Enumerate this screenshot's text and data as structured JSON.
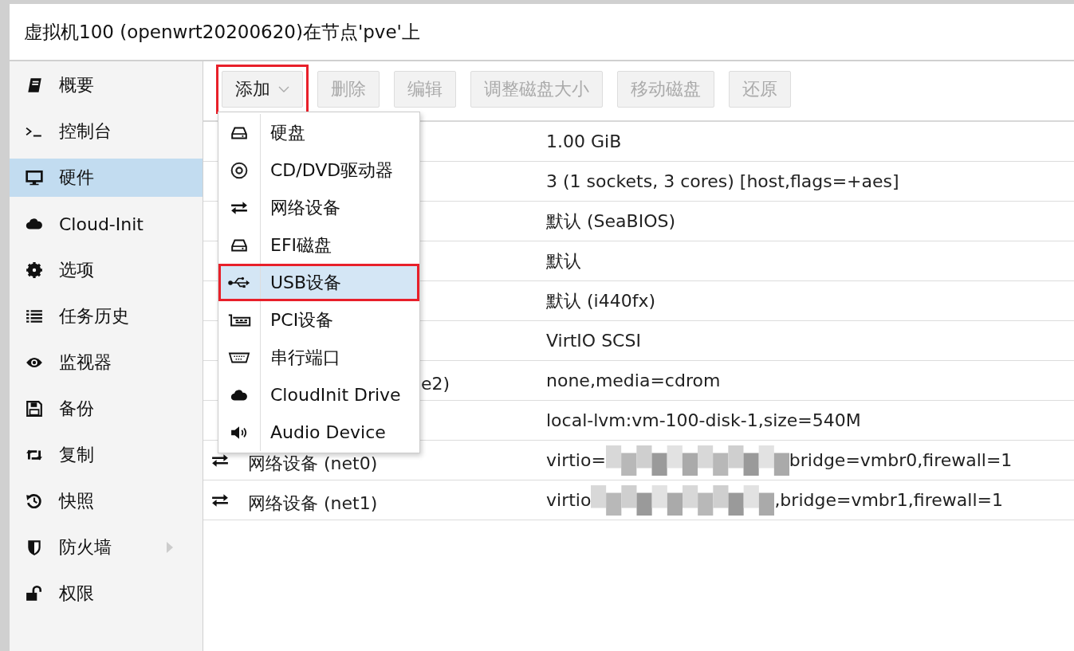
{
  "window": {
    "title": "虚拟机100 (openwrt20200620)在节点'pve'上"
  },
  "sidebar": {
    "items": [
      {
        "label": "概要",
        "selected": false,
        "expandable": false
      },
      {
        "label": "控制台",
        "selected": false,
        "expandable": false
      },
      {
        "label": "硬件",
        "selected": true,
        "expandable": false
      },
      {
        "label": "Cloud-Init",
        "selected": false,
        "expandable": false
      },
      {
        "label": "选项",
        "selected": false,
        "expandable": false
      },
      {
        "label": "任务历史",
        "selected": false,
        "expandable": false
      },
      {
        "label": "监视器",
        "selected": false,
        "expandable": false
      },
      {
        "label": "备份",
        "selected": false,
        "expandable": false
      },
      {
        "label": "复制",
        "selected": false,
        "expandable": false
      },
      {
        "label": "快照",
        "selected": false,
        "expandable": false
      },
      {
        "label": "防火墙",
        "selected": false,
        "expandable": true
      },
      {
        "label": "权限",
        "selected": false,
        "expandable": false
      }
    ]
  },
  "toolbar": {
    "buttons": [
      {
        "label": "添加",
        "disabled": false,
        "dropdown": true,
        "highlighted": true
      },
      {
        "label": "删除",
        "disabled": true,
        "dropdown": false,
        "highlighted": false
      },
      {
        "label": "编辑",
        "disabled": true,
        "dropdown": false,
        "highlighted": false
      },
      {
        "label": "调整磁盘大小",
        "disabled": true,
        "dropdown": false,
        "highlighted": false
      },
      {
        "label": "移动磁盘",
        "disabled": true,
        "dropdown": false,
        "highlighted": false
      },
      {
        "label": "还原",
        "disabled": true,
        "dropdown": false,
        "highlighted": false
      }
    ]
  },
  "table": {
    "rows": [
      {
        "value": "1.00 GiB"
      },
      {
        "value": "3 (1 sockets, 3 cores) [host,flags=+aes]"
      },
      {
        "value": "默认 (SeaBIOS)"
      },
      {
        "value": "默认"
      },
      {
        "value": "默认 (i440fx)"
      },
      {
        "value": "VirtIO SCSI"
      },
      {
        "name": "e2)",
        "value": "none,media=cdrom"
      },
      {
        "value": "local-lvm:vm-100-disk-1,size=540M"
      },
      {
        "kind": "network",
        "name": "网络设备 (net0)",
        "value": "virtio=",
        "value_tail": "bridge=vmbr0,firewall=1"
      },
      {
        "kind": "network",
        "name": "网络设备 (net1)",
        "value": "virtio",
        "value_tail": ",bridge=vmbr1,firewall=1"
      }
    ]
  },
  "add_menu": {
    "items": [
      {
        "label": "硬盘",
        "selected": false,
        "highlighted": false
      },
      {
        "label": "CD/DVD驱动器",
        "selected": false,
        "highlighted": false
      },
      {
        "label": "网络设备",
        "selected": false,
        "highlighted": false
      },
      {
        "label": "EFI磁盘",
        "selected": false,
        "highlighted": false
      },
      {
        "label": "USB设备",
        "selected": true,
        "highlighted": true
      },
      {
        "label": "PCI设备",
        "selected": false,
        "highlighted": false
      },
      {
        "label": "串行端口",
        "selected": false,
        "highlighted": false
      },
      {
        "label": "CloudInit Drive",
        "selected": false,
        "highlighted": false
      },
      {
        "label": "Audio Device",
        "selected": false,
        "highlighted": false
      }
    ]
  }
}
